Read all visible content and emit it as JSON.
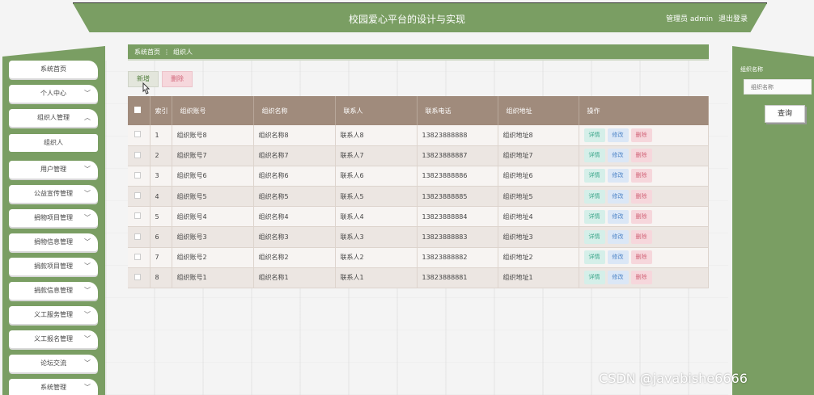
{
  "header": {
    "title": "校园爱心平台的设计与实现",
    "role": "管理员 admin",
    "logout": "退出登录"
  },
  "sidebar": {
    "items": [
      {
        "label": "系统首页",
        "chevron": false
      },
      {
        "label": "个人中心",
        "chevron": true
      },
      {
        "label": "组织人管理",
        "chevron": true,
        "expanded": true
      },
      {
        "label": "组织人",
        "sub": true
      },
      {
        "label": "用户管理",
        "chevron": true
      },
      {
        "label": "公益宣传管理",
        "chevron": true
      },
      {
        "label": "捐物项目管理",
        "chevron": true
      },
      {
        "label": "捐物信息管理",
        "chevron": true
      },
      {
        "label": "捐款项目管理",
        "chevron": true
      },
      {
        "label": "捐款信息管理",
        "chevron": true
      },
      {
        "label": "义工服务管理",
        "chevron": true
      },
      {
        "label": "义工报名管理",
        "chevron": true
      },
      {
        "label": "论坛交流",
        "chevron": true
      },
      {
        "label": "系统管理",
        "chevron": true
      }
    ]
  },
  "breadcrumb": {
    "home": "系统首页",
    "separator": "⋮",
    "current": "组织人"
  },
  "actions": {
    "add": "新增",
    "delete": "删除"
  },
  "table": {
    "headers": {
      "index": "索引",
      "account": "组织账号",
      "name": "组织名称",
      "contact": "联系人",
      "phone": "联系电话",
      "address": "组织地址",
      "ops": "操作"
    },
    "op_labels": {
      "detail": "详情",
      "edit": "修改",
      "delete": "删除"
    },
    "rows": [
      {
        "index": "1",
        "account": "组织账号8",
        "name": "组织名称8",
        "contact": "联系人8",
        "phone": "13823888888",
        "address": "组织地址8"
      },
      {
        "index": "2",
        "account": "组织账号7",
        "name": "组织名称7",
        "contact": "联系人7",
        "phone": "13823888887",
        "address": "组织地址7"
      },
      {
        "index": "3",
        "account": "组织账号6",
        "name": "组织名称6",
        "contact": "联系人6",
        "phone": "13823888886",
        "address": "组织地址6"
      },
      {
        "index": "4",
        "account": "组织账号5",
        "name": "组织名称5",
        "contact": "联系人5",
        "phone": "13823888885",
        "address": "组织地址5"
      },
      {
        "index": "5",
        "account": "组织账号4",
        "name": "组织名称4",
        "contact": "联系人4",
        "phone": "13823888884",
        "address": "组织地址4"
      },
      {
        "index": "6",
        "account": "组织账号3",
        "name": "组织名称3",
        "contact": "联系人3",
        "phone": "13823888883",
        "address": "组织地址3"
      },
      {
        "index": "7",
        "account": "组织账号2",
        "name": "组织名称2",
        "contact": "联系人2",
        "phone": "13823888882",
        "address": "组织地址2"
      },
      {
        "index": "8",
        "account": "组织账号1",
        "name": "组织名称1",
        "contact": "联系人1",
        "phone": "13823888881",
        "address": "组织地址1"
      }
    ]
  },
  "search": {
    "label": "组织名称",
    "placeholder": "组织名称",
    "button": "查询"
  },
  "watermark": "CSDN @javabishe6666",
  "colors": {
    "primary": "#7a9e63",
    "table_header": "#a08b7c"
  }
}
